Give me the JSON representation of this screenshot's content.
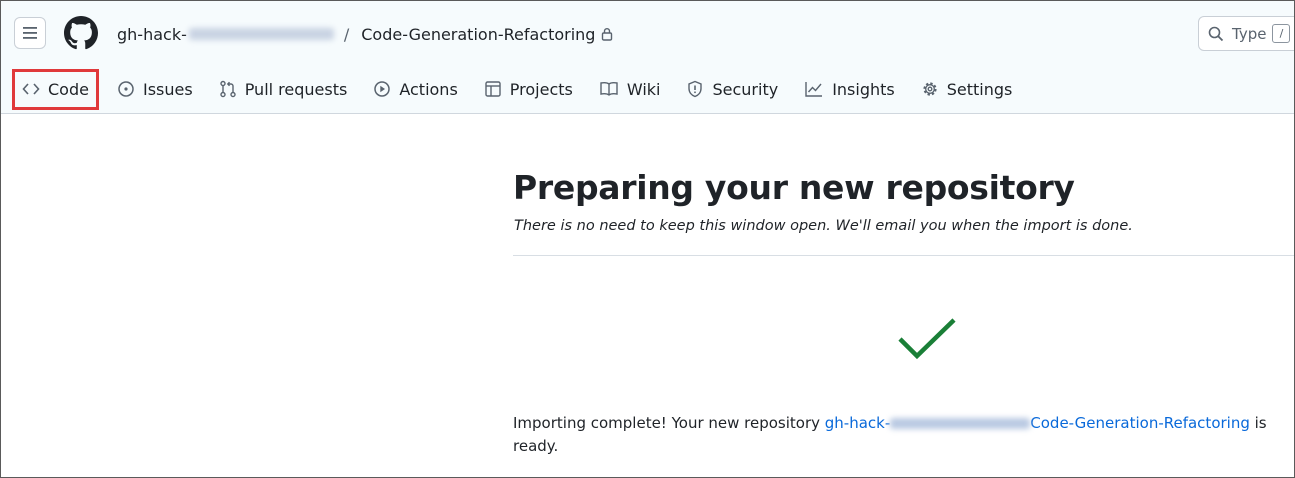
{
  "header": {
    "owner_prefix": "gh-hack-",
    "owner_suffix_redacted": "",
    "separator": "/",
    "repo_name": "Code-Generation-Refactoring",
    "search_placeholder": "Type",
    "search_shortcut": "/"
  },
  "nav": {
    "tabs": [
      {
        "label": "Code",
        "icon": "code-icon",
        "selected": true
      },
      {
        "label": "Issues",
        "icon": "issue-opened-icon"
      },
      {
        "label": "Pull requests",
        "icon": "git-pull-request-icon"
      },
      {
        "label": "Actions",
        "icon": "play-icon"
      },
      {
        "label": "Projects",
        "icon": "table-icon"
      },
      {
        "label": "Wiki",
        "icon": "book-icon"
      },
      {
        "label": "Security",
        "icon": "shield-icon"
      },
      {
        "label": "Insights",
        "icon": "graph-icon"
      },
      {
        "label": "Settings",
        "icon": "gear-icon"
      }
    ]
  },
  "main": {
    "title": "Preparing your new repository",
    "subtitle": "There is no need to keep this window open. We'll email you when the import is done.",
    "status_icon": "check-icon",
    "message_prefix": "Importing complete! Your new repository ",
    "repo_link_prefix": "gh-hack-",
    "repo_link_suffix": "Code-Generation-Refactoring",
    "message_suffix_inline": " is",
    "message_suffix": "ready."
  },
  "colors": {
    "highlight_border": "#e0393b",
    "link": "#0969da",
    "success": "#1a7f37",
    "header_bg": "#f6fbfd"
  }
}
